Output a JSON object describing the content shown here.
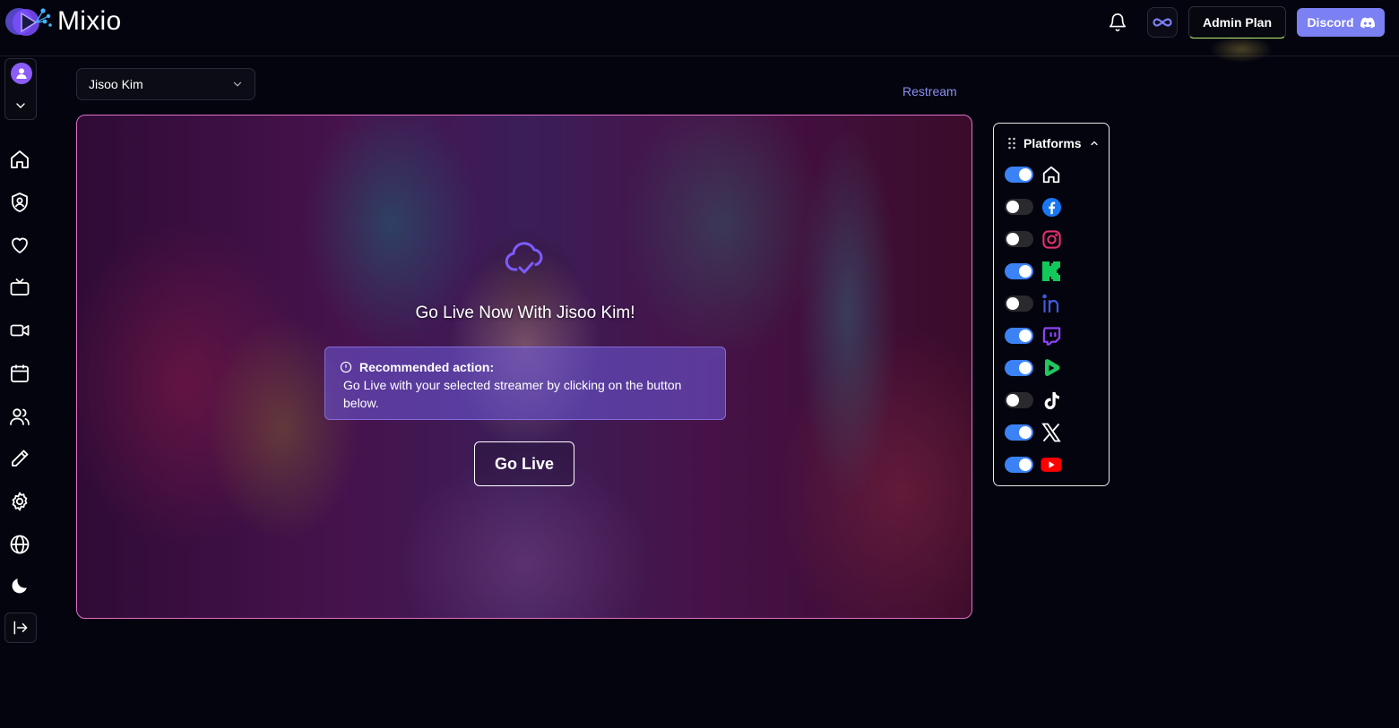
{
  "app": {
    "name": "Mixio"
  },
  "header": {
    "admin_plan_label": "Admin Plan",
    "discord_label": "Discord"
  },
  "colors": {
    "background": "#04040f",
    "accent": "#7b80f2",
    "toggle_on": "#3b82f6",
    "link": "#8a8ff5",
    "stage_border": "#e070c8"
  },
  "sidebar": {
    "items": [
      {
        "icon": "home-icon"
      },
      {
        "icon": "shield-user-icon"
      },
      {
        "icon": "heart-icon"
      },
      {
        "icon": "tv-icon"
      },
      {
        "icon": "video-camera-icon"
      },
      {
        "icon": "calendar-icon"
      },
      {
        "icon": "users-icon"
      },
      {
        "icon": "pencil-icon"
      },
      {
        "icon": "gear-icon"
      },
      {
        "icon": "globe-icon"
      },
      {
        "icon": "moon-icon"
      }
    ]
  },
  "main": {
    "streamer_select": {
      "value": "Jisoo Kim"
    },
    "restream_label": "Restream",
    "stage": {
      "title": "Go Live Now With Jisoo Kim!",
      "notice_title": "Recommended action:",
      "notice_body": "Go Live with your selected streamer by clicking on the button below.",
      "go_live_label": "Go Live"
    }
  },
  "platforms": {
    "title": "Platforms",
    "items": [
      {
        "name": "home",
        "icon": "home-icon",
        "enabled": true
      },
      {
        "name": "facebook",
        "icon": "facebook-icon",
        "enabled": false
      },
      {
        "name": "instagram",
        "icon": "instagram-icon",
        "enabled": false
      },
      {
        "name": "kick",
        "icon": "kick-icon",
        "enabled": true
      },
      {
        "name": "linkedin",
        "icon": "linkedin-icon",
        "enabled": false
      },
      {
        "name": "twitch",
        "icon": "twitch-icon",
        "enabled": true
      },
      {
        "name": "rumble",
        "icon": "rumble-icon",
        "enabled": true
      },
      {
        "name": "tiktok",
        "icon": "tiktok-icon",
        "enabled": false
      },
      {
        "name": "x",
        "icon": "x-icon",
        "enabled": true
      },
      {
        "name": "youtube",
        "icon": "youtube-icon",
        "enabled": true
      }
    ]
  }
}
